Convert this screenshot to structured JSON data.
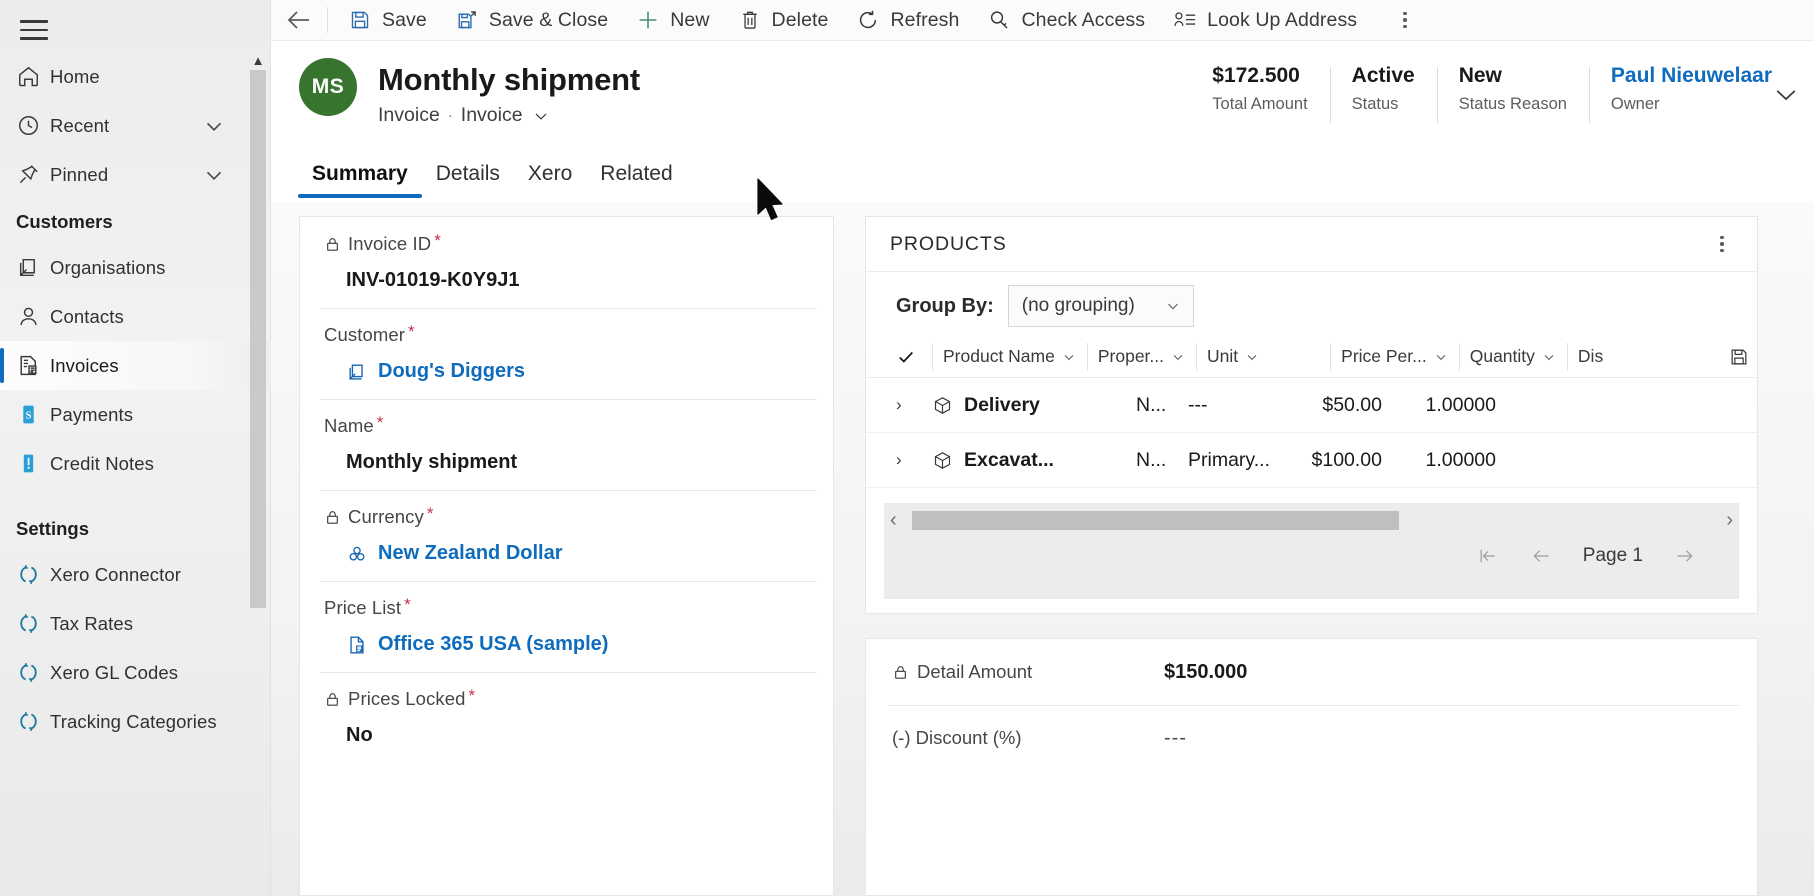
{
  "app": {
    "brand_blue": "#0f6cbd",
    "avatar_green": "#37752f",
    "required_red": "#c4314b"
  },
  "sidebar": {
    "menu_button": "menu-icon",
    "items": [
      {
        "label": "Home",
        "icon": "home-icon",
        "chevron": false,
        "selected": false
      },
      {
        "label": "Recent",
        "icon": "clock-icon",
        "chevron": true,
        "selected": false
      },
      {
        "label": "Pinned",
        "icon": "pin-icon",
        "chevron": true,
        "selected": false
      }
    ],
    "groups": [
      {
        "title": "Customers",
        "items": [
          {
            "label": "Organisations",
            "icon": "organisation-icon",
            "selected": false
          },
          {
            "label": "Contacts",
            "icon": "contact-icon",
            "selected": false
          },
          {
            "label": "Invoices",
            "icon": "invoice-icon",
            "selected": true
          },
          {
            "label": "Payments",
            "icon": "payment-icon",
            "selected": false
          },
          {
            "label": "Credit Notes",
            "icon": "credit-note-icon",
            "selected": false
          }
        ]
      },
      {
        "title": "Settings",
        "items": [
          {
            "label": "Xero Connector",
            "icon": "sync-icon",
            "selected": false
          },
          {
            "label": "Tax Rates",
            "icon": "sync-icon",
            "selected": false
          },
          {
            "label": "Xero GL Codes",
            "icon": "sync-icon",
            "selected": false
          },
          {
            "label": "Tracking Categories",
            "icon": "sync-icon",
            "selected": false
          }
        ]
      }
    ]
  },
  "commandbar": {
    "back": "back-arrow-icon",
    "buttons": [
      {
        "label": "Save",
        "icon": "save-icon"
      },
      {
        "label": "Save & Close",
        "icon": "save-close-icon"
      },
      {
        "label": "New",
        "icon": "plus-icon"
      },
      {
        "label": "Delete",
        "icon": "trash-icon"
      },
      {
        "label": "Refresh",
        "icon": "refresh-icon"
      },
      {
        "label": "Check Access",
        "icon": "key-icon"
      },
      {
        "label": "Look Up Address",
        "icon": "address-list-icon"
      }
    ],
    "overflow": "more-vertical-icon"
  },
  "record": {
    "avatar_initials": "MS",
    "title": "Monthly shipment",
    "entity": "Invoice",
    "form_name": "Invoice",
    "header_stats": [
      {
        "value": "$172.500",
        "label": "Total Amount",
        "is_link": false
      },
      {
        "value": "Active",
        "label": "Status",
        "is_link": false
      },
      {
        "value": "New",
        "label": "Status Reason",
        "is_link": false
      },
      {
        "value": "Paul Nieuwelaar",
        "label": "Owner",
        "is_link": true
      }
    ]
  },
  "tabs": [
    {
      "label": "Summary",
      "active": true
    },
    {
      "label": "Details",
      "active": false
    },
    {
      "label": "Xero",
      "active": false
    },
    {
      "label": "Related",
      "active": false
    }
  ],
  "form_fields": [
    {
      "label": "Invoice ID",
      "required": true,
      "locked": true,
      "value": "INV-01019-K0Y9J1",
      "link": false,
      "icon": null
    },
    {
      "label": "Customer",
      "required": true,
      "locked": false,
      "value": "Doug's Diggers",
      "link": true,
      "icon": "organisation-icon"
    },
    {
      "label": "Name",
      "required": true,
      "locked": false,
      "value": "Monthly shipment",
      "link": false,
      "icon": null
    },
    {
      "label": "Currency",
      "required": true,
      "locked": true,
      "value": "New Zealand Dollar",
      "link": true,
      "icon": "currency-icon"
    },
    {
      "label": "Price List",
      "required": true,
      "locked": false,
      "value": "Office 365 USA (sample)",
      "link": true,
      "icon": "pricelist-icon"
    },
    {
      "label": "Prices Locked",
      "required": true,
      "locked": true,
      "value": "No",
      "link": false,
      "icon": null
    }
  ],
  "products": {
    "title": "PRODUCTS",
    "more": "more-vertical-icon",
    "group_by_label": "Group By:",
    "group_by_value": "(no grouping)",
    "columns": [
      {
        "label": "Product Name"
      },
      {
        "label": "Proper..."
      },
      {
        "label": "Unit"
      },
      {
        "label": "Price Per..."
      },
      {
        "label": "Quantity"
      },
      {
        "label": "Dis"
      }
    ],
    "select_all_icon": "checkmark-icon",
    "save_grid_icon": "save-icon",
    "rows": [
      {
        "name": "Delivery",
        "property": "N...",
        "unit": "---",
        "price": "$50.00",
        "quantity": "1.00000"
      },
      {
        "name": "Excavat...",
        "property": "N...",
        "unit": "Primary...",
        "price": "$100.00",
        "quantity": "1.00000"
      }
    ],
    "pager": {
      "first": "first-page-icon",
      "previous": "previous-page-icon",
      "label": "Page 1",
      "next": "next-page-icon"
    },
    "hscroll_left": "scroll-left-icon",
    "hscroll_right": "scroll-right-icon"
  },
  "totals": [
    {
      "label": "Detail Amount",
      "locked": true,
      "value": "$150.000",
      "muted": false
    },
    {
      "label": "(-) Discount (%)",
      "locked": false,
      "value": "---",
      "muted": true
    }
  ]
}
